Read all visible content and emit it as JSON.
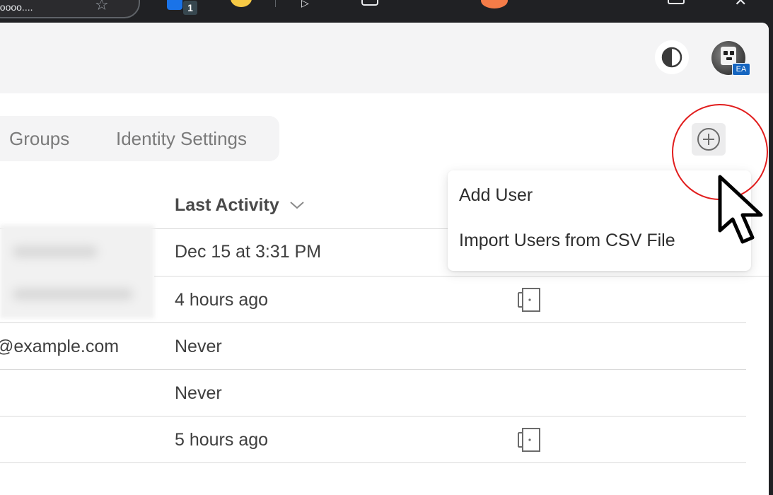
{
  "browser": {
    "omnibox_fragment": "ooooo....",
    "extension_badge": "1"
  },
  "header": {
    "theme_toggle": "contrast-icon",
    "avatar_badge": "EA"
  },
  "tabs": [
    {
      "label": "Groups"
    },
    {
      "label": "Identity Settings"
    }
  ],
  "table": {
    "sort_column": "Last Activity",
    "rows": [
      {
        "email": "",
        "last_activity": "Dec 15 at 3:31 PM",
        "action_icon": ""
      },
      {
        "email": "",
        "last_activity": "4 hours ago",
        "action_icon": "door-icon"
      },
      {
        "email": "@example.com",
        "last_activity": "Never",
        "action_icon": ""
      },
      {
        "email": "",
        "last_activity": "Never",
        "action_icon": ""
      },
      {
        "email": "",
        "last_activity": "5 hours ago",
        "action_icon": "door-icon"
      }
    ]
  },
  "add_menu": {
    "items": [
      {
        "label": "Add User"
      },
      {
        "label": "Import Users from CSV File"
      }
    ]
  },
  "colors": {
    "highlight": "#e11d1d",
    "header_bg": "#f4f4f5"
  }
}
